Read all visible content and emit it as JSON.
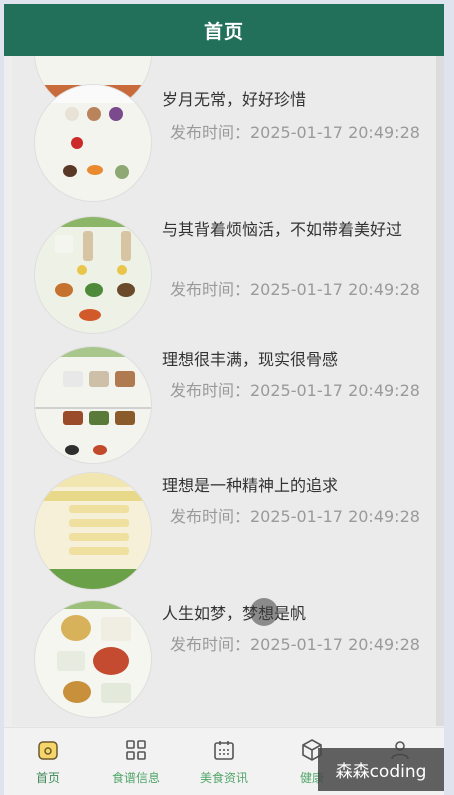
{
  "header": {
    "title": "首页"
  },
  "articles": [
    {
      "title": "岁月无常，好好珍惜",
      "time": "发布时间：2025-01-17 20:49:28"
    },
    {
      "title": "与其背着烦恼活，不如带着美好过",
      "time": "发布时间：2025-01-17 20:49:28"
    },
    {
      "title": "理想很丰满，现实很骨感",
      "time": "发布时间：2025-01-17 20:49:28"
    },
    {
      "title": "理想是一种精神上的追求",
      "time": "发布时间：2025-01-17 20:49:28"
    },
    {
      "title": "人生如梦，梦想是帆",
      "time": "发布时间：2025-01-17 20:49:28"
    }
  ],
  "tabs": [
    {
      "label": "首页",
      "icon": "home-icon"
    },
    {
      "label": "食谱信息",
      "icon": "grid-icon"
    },
    {
      "label": "美食资讯",
      "icon": "calendar-icon"
    },
    {
      "label": "健康",
      "icon": "box-icon"
    },
    {
      "label": "",
      "icon": "user-icon"
    }
  ],
  "watermark": "森森coding",
  "colors": {
    "header": "#23705a",
    "tab_text": "#52a56a"
  }
}
